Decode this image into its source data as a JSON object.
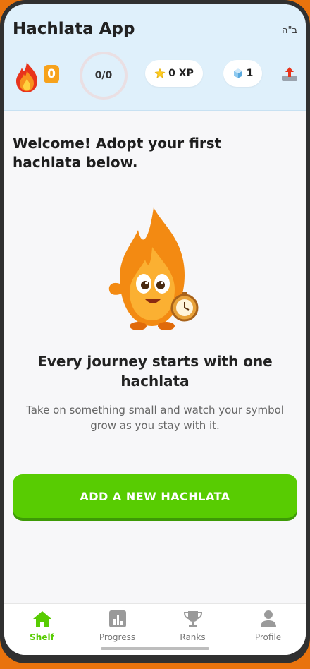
{
  "header": {
    "app_title": "Hachlata App",
    "bh_text": "ב\"ה",
    "streak_count": "0",
    "progress_text": "0/0",
    "xp_text": "0 XP",
    "gems_count": "1"
  },
  "main": {
    "welcome_text": "Welcome! Adopt your first hachlata below.",
    "journey_title": "Every journey starts with one hachlata",
    "journey_subtitle": "Take on something small and watch your symbol grow as you stay with it.",
    "add_button_label": "ADD A NEW HACHLATA"
  },
  "nav": {
    "items": [
      {
        "label": "Shelf",
        "icon": "home-icon",
        "active": true
      },
      {
        "label": "Progress",
        "icon": "chart-icon",
        "active": false
      },
      {
        "label": "Ranks",
        "icon": "trophy-icon",
        "active": false
      },
      {
        "label": "Profile",
        "icon": "person-icon",
        "active": false
      }
    ]
  },
  "colors": {
    "accent_green": "#58cc02",
    "streak_orange": "#f7a21b",
    "header_bg": "#dff0fb"
  }
}
